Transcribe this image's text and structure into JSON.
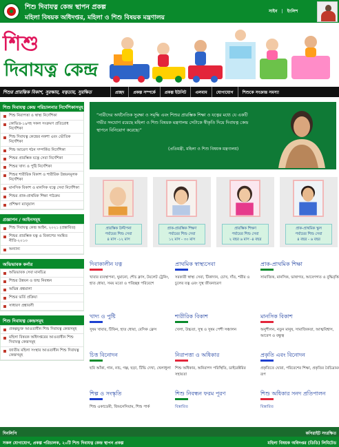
{
  "header": {
    "title_line1": "শিশু দিবাযত্ন কেন্দ্র স্থাপন প্রকল্প",
    "title_line2": "মহিলা বিষয়ক অধিদপ্তর, মহিলা ও শিশু বিষয়ক মন্ত্রণালয়",
    "link_home": "সাইন",
    "link_sep": "|",
    "link_english": "ইংলিশ"
  },
  "banner": {
    "brand_line1": "শিশু",
    "brand_line2": "দিবাযত্ন কেন্দ্র"
  },
  "nav": {
    "tagline": "শিশুর প্রারম্ভিক বিকাশ, সুরক্ষায়, যত্নতায়, সুরক্ষিত",
    "items": [
      "প্রচ্ছদ",
      "প্রকল্প সম্পর্কে",
      "প্রকল্প ইউনিট",
      "এলবাম",
      "যোগাযোগ",
      "শিশুকে সংক্রান্ত সমস্যা"
    ]
  },
  "sidebar": {
    "sec1_title": "শিশু দিবাযত্ন কেন্দ্র পরিচালনার নির্দেশিকাসমূহ",
    "sec1_items": [
      "শিশু নিরাপত্তা ও স্বাস্থ্য নির্দেশিকা",
      "কোভিড-১৯সহ সকল সংক্রমণ প্রতিরোধ নির্দেশিকা",
      "শিশু দিবাযত্ন কেন্দ্রের নকশা এবং ভৌতিক নির্দেশিকা",
      "শিশু আচরণ গঠন সম্পর্কিত নির্দেশিকা",
      "শিশুর প্রারম্ভিক যত্নে সেবা নির্দেশিকা",
      "শিশুর খাদ্য ও পুষ্টি নির্দেশিকা",
      "শিশুর শারীরিক বিকাশ ও শারীরিক উন্নয়নমূলক নির্দেশিকা",
      "মানসিক বিকাশ ও মানসিক যত্নে সেবা নির্দেশিকা",
      "শিশুর প্রাক-প্রাথমিক শিক্ষা পাঠক্রম",
      "প্রশিক্ষণ ম্যানুয়াল"
    ],
    "sec2_title": "প্রজ্ঞাপন / আইনসমূহ",
    "sec2_items": [
      "শিশু দিবাযত্ন কেন্দ্র আইন, ২০২১ (প্রস্তাবিত)",
      "শিশুর প্রারম্ভিক যত্ন ও বিকাশের সমন্বিত নীতি-২০১৩",
      "অন্যান্য"
    ],
    "sec3_title": "অভিভাবক কর্নার",
    "sec3_items": [
      "অভিভাবক সেবা মানচিত্র",
      "শিশুর উন্নয়ন ও জন্ম নিবন্ধন",
      "অভিন্ন প্রশ্নমালা",
      "শিশুর ভর্তি প্রক্রিয়া",
      "সাধারণ প্রশ্নাবলী"
    ],
    "sec4_title": "শিশু দিবাযত্ন কেন্দ্রসমূহ",
    "sec4_items": [
      "প্রকল্পভুক্ত আওতাধীন শিশু দিবাযত্ন কেন্দ্রসমূহ",
      "মহিলা বিষয়ক অধিদপ্তরের আওতাধীন শিশু দিবাযত্ন কেন্দ্রসমূহ",
      "জাতীয় মহিলা সংস্থার আওতাধীন শিশু দিবাযত্ন কেন্দ্রসমূহ"
    ]
  },
  "quote": {
    "text": "“নারীদের অর্থনৈতিক সুরক্ষা ও সমৃদ্ধি এবং শিশুর প্রারম্ভিক শিক্ষা ও যত্নের মধ্যে যে একটি গভীর সংযোগ রয়েছে মহিলা ও শিশু বিষয়ক মন্ত্রণালয় সেটাকে স্বীকৃতি দিয়ে দিবাযত্ন কেন্দ্র স্থাপনে বিনিয়োগ করেছে।”",
    "cite": "(প্রতিমন্ত্রী, মহিলা ও শিশু বিষয়ক মন্ত্রণালয়)"
  },
  "age_cards": [
    {
      "line1": "প্রারম্ভিক উদ্দীপনা",
      "line2": "পর্যায়ের শিশু সেবা",
      "line3": "৪ মাস -১২ মাস"
    },
    {
      "line1": "প্রাক-প্রারম্ভিক শিক্ষণ",
      "line2": "পর্যায়ের শিশু সেবা",
      "line3": "১২ মাস - ৩০ মাস"
    },
    {
      "line1": "প্রারম্ভিক শিক্ষণ",
      "line2": "পর্যায়ের শিশু সেবা",
      "line3": "২ বছর ৬ মাস -৪ বছর"
    },
    {
      "line1": "প্রাক-প্রাথমিক স্কুল",
      "line2": "পর্যায়ের শিশু সেবা",
      "line3": "৪ বছর - ৬ বছর"
    }
  ],
  "info": [
    {
      "title": "দিবাকালীন যত্ন",
      "desc": "খাবার ব্যবস্থাপনা, ঘুমানো, শৌচ ক্লাস, টয়লেট ট্রেনিং, হাত ধোয়া, সময় মতো ও পরিচ্ছন্ন পরিবেশে"
    },
    {
      "title": "প্রাথমিক স্বাস্থ্যসেবা",
      "desc": "সরকারী স্বাস্থ্য সেবা, টিকাদান, চোখ, দাঁত, শরীর ও চুলের যত্ন এবং সুস্থ জীবনাচরণ"
    },
    {
      "title": "প্রাক-প্রাথমিক শিক্ষা",
      "desc": "সামাজিক, মানসিক, ভাষাগত, আবেগগত ও বুদ্ধিবৃত্তিক"
    },
    {
      "title": "খাদ্য ও পুষ্টি",
      "desc": "সুষম খাবার, টিফিন, হাত ধোয়া, বেসিক ফ্রেস"
    },
    {
      "title": "শারীরিক বিকাশ",
      "desc": "খেলা, উচ্চতা, সুস্থ ও সুষম পেশী সঞ্চালন"
    },
    {
      "title": "মানসিক বিকাশ",
      "desc": "অনুশীলন, নতুন মানুষ, সামাজিকতা, আত্মবিশ্বাস, আবেগ ও বন্ধুত্ব"
    },
    {
      "title": "চিত্ত বিনোদন",
      "desc": "ছবি আঁকা, গান, নাচ, গল্প, ছড়া, টিভি দেখা, খেলাধুলা"
    },
    {
      "title": "নিরাপত্তা ও অধিকার",
      "desc": "শিশু অধিকার, অনিরাপদ পরিস্থিতি, ডাইরেক্টরির সহায়তা"
    },
    {
      "title": "প্রকৃতি এবং বিনোদন",
      "desc": "প্রকৃতিতে ঘোরা, পরিবেশের শিক্ষা, প্রকৃতির বৈচিত্র্যময় রূপ"
    },
    {
      "title": "শিল্প ও সংস্কৃতি",
      "desc": "শিশু একাডেমী, জিমনেসিয়াম, শিশু পার্ক"
    },
    {
      "title": "শিশু নিবন্ধন ফরম পূরণ",
      "desc": "বিস্তারিত"
    },
    {
      "title": "শিশু অধিকার সনদ প্রতিপালন",
      "desc": "বিস্তারিত"
    }
  ],
  "footer": {
    "left1": "দিনলিপি",
    "right1": "কপিরাইট সংরক্ষিত",
    "left2": "সকল যোগাযোগ, প্রকল্প পরিচালক, ২০টি শিশু দিবাযত্ন কেন্দ্র স্থাপন প্রকল্প",
    "right2": "মহিলা বিষয়ক অধিদপ্তর (ডিডি) লিমিটেড"
  },
  "colors": {
    "green": "#0a8a2c",
    "dark": "#111111",
    "pink": "#e0175c",
    "link_blue": "#1a3c9e",
    "accent_red": "#e3253a"
  }
}
